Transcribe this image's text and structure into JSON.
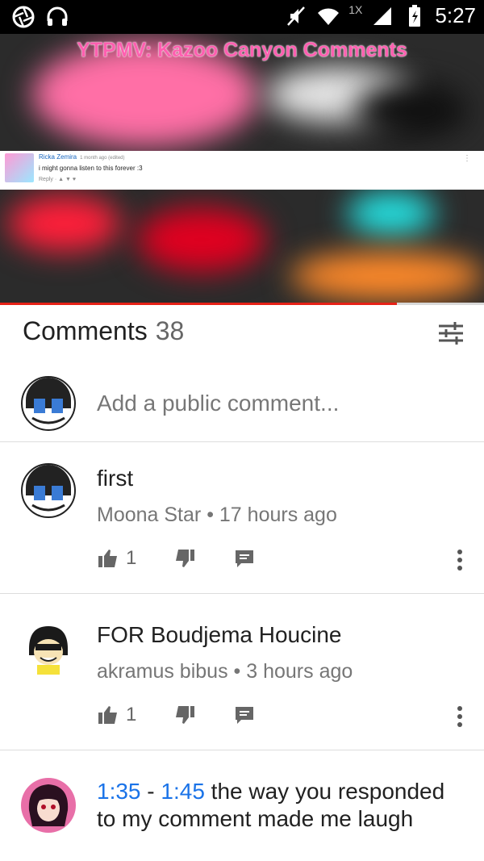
{
  "status_bar": {
    "time": "5:27",
    "network_label": "1X"
  },
  "video": {
    "title": "YTPMV: Kazoo Canyon Comments",
    "progress": 0.82,
    "embedded_comment": {
      "author": "Ricka Zemira",
      "time": "1 month ago (edited)",
      "text": "i might gonna listen to this forever :3",
      "actions": "Reply ·"
    }
  },
  "comments_header": {
    "label": "Comments",
    "count": "38"
  },
  "add_comment": {
    "placeholder": "Add a public comment..."
  },
  "comments": [
    {
      "text": "first",
      "author": "Moona Star",
      "time": "17 hours ago",
      "likes": "1"
    },
    {
      "text": "FOR Boudjema  Houcine",
      "author": "akramus bibus",
      "time": "3 hours ago",
      "likes": "1"
    },
    {
      "ts_start": "1:35",
      "ts_sep": " - ",
      "ts_end": "1:45",
      "text": " the way you responded to my comment made me laugh"
    }
  ],
  "meta_separator": " • ",
  "colors": {
    "accent_red": "#e62117",
    "link_blue": "#1a73e8",
    "title_pink": "#ff5fb0"
  }
}
